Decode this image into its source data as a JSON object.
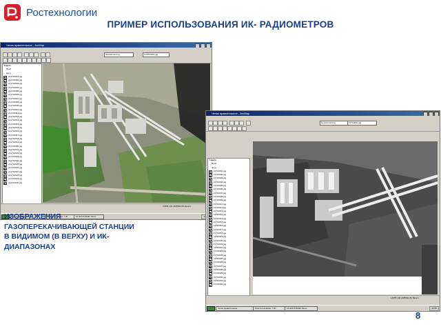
{
  "logo": {
    "text": "Ростехнологии"
  },
  "title": "ПРИМЕР ИСПОЛЬЗОВАНИЯ ИК- РАДИОМЕТРОВ",
  "caption": [
    "ИЗОБРАЖЕНИЯ",
    "ГАЗОПЕРЕКАЧИВАЮЩЕЙ СТАНЦИИ",
    "В ВИДИМОМ (В ВЕРХУ) И ИК-",
    "ДИАПАЗОНАХ"
  ],
  "page_number": "8",
  "colors": {
    "brand_blue": "#1a3f8f",
    "logo_red": "#d4202a"
  },
  "windows": [
    {
      "id": "visible",
      "title": "Четка правительное - ArcMap",
      "menu": [
        "File",
        "Edit",
        "View",
        "Insert",
        "Selection",
        "Tools",
        "Window",
        "Help"
      ],
      "layer_field": "vis1710001.jpg",
      "georef_label": "Georeferencing",
      "toc": {
        "root": "Layers",
        "group": "Проб",
        "sub": "Jpeg",
        "items": [
          "vis1710001.jpg",
          "vis1710002.jpg",
          "vis1710003.jpg",
          "vis1710004.jpg",
          "vis1710005.jpg",
          "vis1710006.jpg",
          "vis1710007.jpg",
          "vis1710008.jpg",
          "vis1710009.jpg",
          "vis1710010.jpg",
          "vis1710011.jpg",
          "vis1710012.jpg",
          "vis1710013.jpg",
          "vis1710014.jpg",
          "vis1710015.jpg",
          "vis1710016.jpg",
          "vis1710017.jpg",
          "vis1710018.jpg",
          "vis1710019.jpg",
          "vis1710020.jpg",
          "vis1710021.jpg",
          "vis1710022.jpg",
          "vis1710023.jpg",
          "vis1710024.jpg",
          "vis1710025.jpg",
          "vis1710026.jpg",
          "vis1710027.jpg",
          "vis1710028.jpg",
          "vis1710029.jpg",
          "vis1710030.jpg"
        ]
      },
      "status_coords": "13355.134  2185662.84 Meters",
      "taskbar": {
        "start": "Start",
        "tasks": [
          "Четка правительное",
          "Total Commander 7.0b",
          "1F-ENCS 8H3C Mosc"
        ],
        "clock": "13:55"
      }
    },
    {
      "id": "infrared",
      "title": "Четка правительное - ArcMap",
      "menu": [
        "File",
        "Edit",
        "View",
        "Insert",
        "Selection",
        "Tools",
        "Window",
        "Help"
      ],
      "layer_field": "ir1710001.jpg",
      "georef_label": "Georeferencing",
      "toc": {
        "root": "Layers",
        "group": "Проб",
        "sub": "Jpeg",
        "items": [
          "ir1710001.jpg",
          "ir1710002.jpg",
          "ir1710003.jpg",
          "ir1710004.jpg",
          "ir1710005.jpg",
          "ir1710006.jpg",
          "ir1710007.jpg",
          "ir1710008.jpg",
          "ir1710009.jpg",
          "ir1710010.jpg",
          "ir1710011.jpg",
          "ir1710012.jpg",
          "ir1710013.jpg",
          "ir1710014.jpg",
          "ir1710015.jpg",
          "ir1710016.jpg",
          "ir1710017.jpg",
          "ir1710018.jpg",
          "ir1710019.jpg",
          "ir1710020.jpg",
          "ir1710021.jpg",
          "ir1710022.jpg",
          "ir1710023.jpg",
          "ir1710024.jpg",
          "ir1710025.jpg",
          "ir1710026.jpg",
          "ir1710027.jpg",
          "ir1710028.jpg",
          "ir1710029.jpg",
          "ir1710030.jpg",
          "ir1710031.jpg",
          "ir1710032.jpg"
        ]
      },
      "status_coords": "13355.134  2185662.84 Meters",
      "taskbar": {
        "start": "Start",
        "tasks": [
          "Четка правительное",
          "Total Commander 7.0b",
          "1F-ENCS 8H3C Mosc"
        ],
        "clock": "13:55"
      }
    }
  ]
}
